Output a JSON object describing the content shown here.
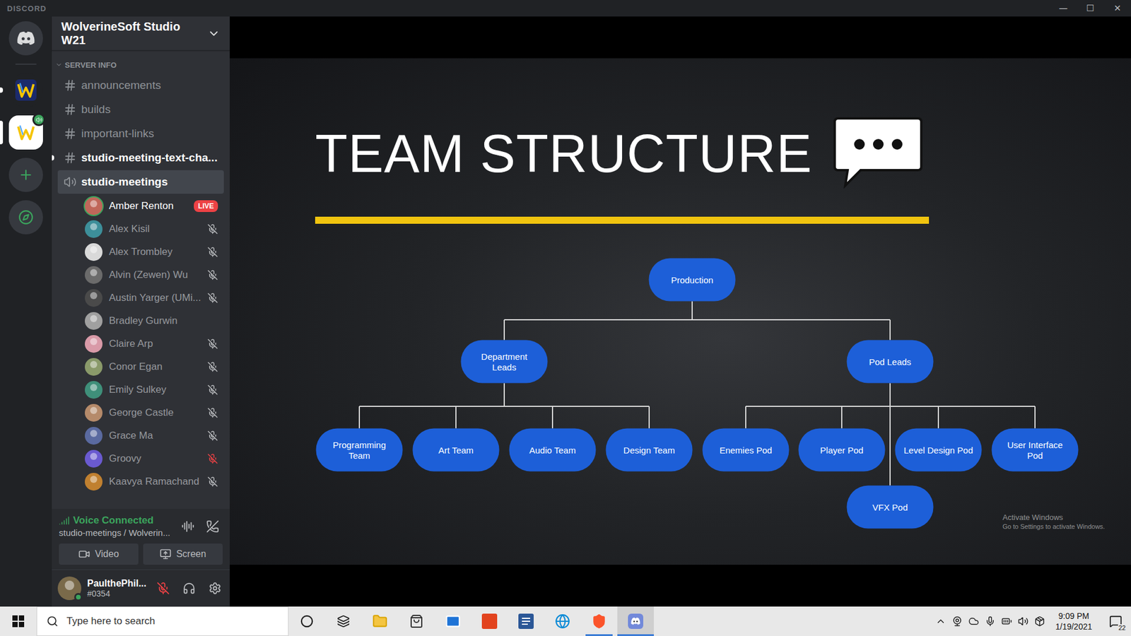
{
  "window": {
    "title": "DISCORD",
    "controls": [
      "—",
      "☐",
      "✕"
    ]
  },
  "servers": [
    {
      "unread": true,
      "selected": false
    },
    {
      "unread": false,
      "selected": true
    }
  ],
  "server": {
    "name": "WolverineSoft Studio W21"
  },
  "category": {
    "label": "SERVER INFO",
    "expanded": true
  },
  "channels": [
    {
      "name": "announcements",
      "kind": "text",
      "unread": false,
      "selected": false
    },
    {
      "name": "builds",
      "kind": "text",
      "unread": false,
      "selected": false
    },
    {
      "name": "important-links",
      "kind": "text",
      "unread": false,
      "selected": false
    },
    {
      "name": "studio-meeting-text-cha...",
      "kind": "text",
      "unread": true,
      "selected": false
    },
    {
      "name": "studio-meetings",
      "kind": "voice",
      "unread": false,
      "selected": true
    }
  ],
  "voice_members": [
    {
      "name": "Amber Renton",
      "live": true,
      "badge": "LIVE",
      "muted": false,
      "server_muted": false,
      "speaking": true,
      "color": "#c0675a"
    },
    {
      "name": "Alex Kisil",
      "live": false,
      "muted": true,
      "server_muted": false,
      "speaking": false,
      "color": "#3d8f9a"
    },
    {
      "name": "Alex Trombley",
      "live": false,
      "muted": true,
      "server_muted": false,
      "speaking": false,
      "color": "#d9d9d9"
    },
    {
      "name": "Alvin (Zewen) Wu",
      "live": false,
      "muted": true,
      "server_muted": false,
      "speaking": false,
      "color": "#6b6b6b"
    },
    {
      "name": "Austin Yarger (UMi...",
      "live": false,
      "muted": true,
      "server_muted": false,
      "speaking": false,
      "color": "#4a4a4a"
    },
    {
      "name": "Bradley Gurwin",
      "live": false,
      "muted": false,
      "server_muted": false,
      "speaking": false,
      "color": "#a0a0a0"
    },
    {
      "name": "Claire Arp",
      "live": false,
      "muted": true,
      "server_muted": false,
      "speaking": false,
      "color": "#d99aa8"
    },
    {
      "name": "Conor Egan",
      "live": false,
      "muted": true,
      "server_muted": false,
      "speaking": false,
      "color": "#8a9a6a"
    },
    {
      "name": "Emily Sulkey",
      "live": false,
      "muted": true,
      "server_muted": false,
      "speaking": false,
      "color": "#3f8f7a"
    },
    {
      "name": "George Castle",
      "live": false,
      "muted": true,
      "server_muted": false,
      "speaking": false,
      "color": "#b58a6a"
    },
    {
      "name": "Grace Ma",
      "live": false,
      "muted": true,
      "server_muted": false,
      "speaking": false,
      "color": "#5a6aa0"
    },
    {
      "name": "Groovy",
      "live": false,
      "muted": true,
      "server_muted": true,
      "speaking": false,
      "color": "#6a5ad0"
    },
    {
      "name": "Kaavya Ramachand",
      "live": false,
      "muted": true,
      "server_muted": false,
      "speaking": false,
      "color": "#c08030"
    }
  ],
  "voice_status": {
    "label": "Voice Connected",
    "channel": "studio-meetings / Wolverin..."
  },
  "voice_buttons": [
    "Video",
    "Screen"
  ],
  "user": {
    "name": "PaulthePhil...",
    "tag": "#0354",
    "muted": true,
    "online": true
  },
  "slide": {
    "title": "TEAM STRUCTURE",
    "diagram": {
      "root": "Production",
      "branches": [
        {
          "label": "Department Leads",
          "children": [
            "Programming Team",
            "Art Team",
            "Audio Team",
            "Design Team"
          ]
        },
        {
          "label": "Pod Leads",
          "children": [
            "Enemies Pod",
            "Player Pod",
            "Level Design Pod",
            "User Interface Pod",
            "VFX Pod"
          ]
        }
      ]
    },
    "watermark": [
      "Activate Windows",
      "Go to Settings to activate Windows."
    ]
  },
  "taskbar": {
    "search_placeholder": "Type here to search",
    "apps": [
      {
        "running": false,
        "selected": false
      },
      {
        "running": false,
        "selected": false
      },
      {
        "running": false,
        "selected": false
      },
      {
        "running": false,
        "selected": false
      },
      {
        "running": false,
        "selected": false
      },
      {
        "running": false,
        "selected": false
      },
      {
        "running": false,
        "selected": false
      },
      {
        "running": false,
        "selected": false
      },
      {
        "running": true,
        "selected": false
      },
      {
        "running": true,
        "selected": true
      }
    ],
    "time": "9:09 PM",
    "date": "1/19/2021",
    "notifications": "22"
  }
}
